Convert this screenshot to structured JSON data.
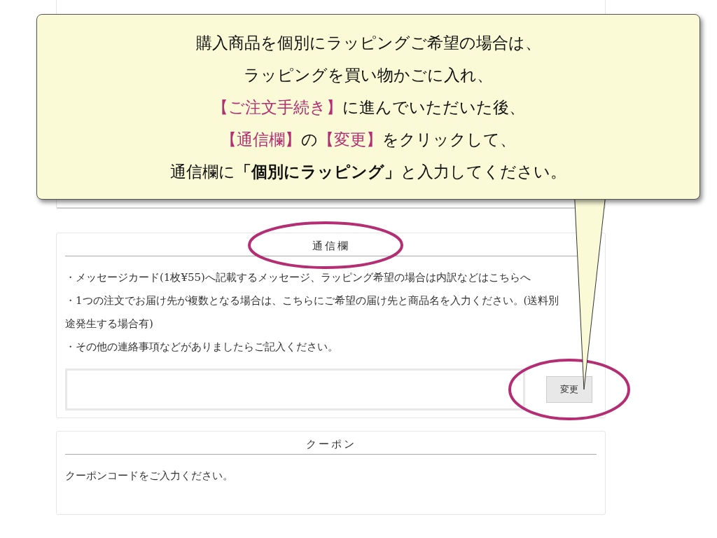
{
  "callout": {
    "lines": [
      [
        {
          "kind": "plain",
          "text": "購入商品を個別にラッピングご希望の場合は、"
        }
      ],
      [
        {
          "kind": "plain",
          "text": "ラッピングを買い物かごに入れ、"
        }
      ],
      [
        {
          "kind": "emphasis",
          "text": "【ご注文手続き】"
        },
        {
          "kind": "plain",
          "text": "に進んでいただいた後、"
        }
      ],
      [
        {
          "kind": "emphasis",
          "text": "【通信欄】"
        },
        {
          "kind": "plain",
          "text": "の"
        },
        {
          "kind": "emphasis",
          "text": "【変更】"
        },
        {
          "kind": "plain",
          "text": "をクリックして、"
        }
      ],
      [
        {
          "kind": "plain",
          "text": "通信欄に"
        },
        {
          "kind": "bold",
          "text": "「個別にラッピング」"
        },
        {
          "kind": "plain",
          "text": "と入力してください。"
        }
      ]
    ]
  },
  "message_section": {
    "heading": "通信欄",
    "notes": [
      "・メッセージカード(1枚¥55)へ記載するメッセージ、ラッピング希望の場合は内訳などはこちらへ",
      "・1つの注文でお届け先が複数となる場合は、こちらにご希望の届け先と商品名を入力ください。(送料別途発生する場合有)",
      "・その他の連絡事項などがありましたらご記入ください。"
    ],
    "button": "変更"
  },
  "coupon_section": {
    "heading": "クーポン",
    "text": "クーポンコードをご入力ください。"
  }
}
